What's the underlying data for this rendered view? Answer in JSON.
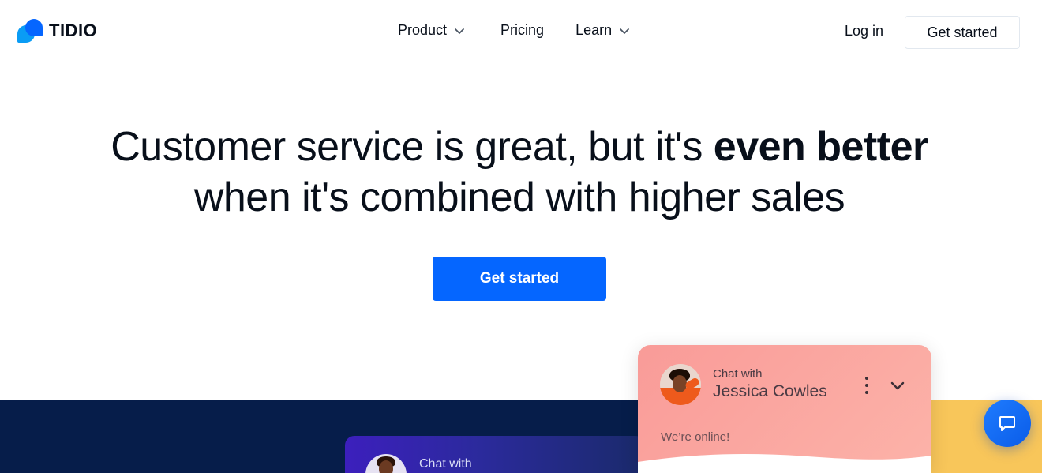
{
  "header": {
    "logo_text": "TIDIO",
    "nav": {
      "product": "Product",
      "pricing": "Pricing",
      "learn": "Learn"
    },
    "login": "Log in",
    "get_started": "Get started"
  },
  "hero": {
    "title_part1": "Customer service is great, but it's ",
    "title_bold": "even better",
    "title_part2": "when it's combined with higher sales",
    "cta": "Get started"
  },
  "background_chat": {
    "chat_with": "Chat with"
  },
  "chat_widget": {
    "chat_with": "Chat with",
    "agent_name": "Jessica Cowles",
    "status": "We’re online!"
  },
  "colors": {
    "brand_blue": "#0566ff",
    "dark_band": "#061d4a",
    "widget_pink": "#f99b98",
    "yellow": "#f8c65a"
  },
  "icons": {
    "logo": "tidio-logo-icon",
    "product_chevron": "chevron-down-icon",
    "learn_chevron": "chevron-down-icon",
    "chat_menu": "more-vertical-icon",
    "chat_minimize": "chevron-down-icon",
    "launcher": "chat-bubble-icon"
  }
}
